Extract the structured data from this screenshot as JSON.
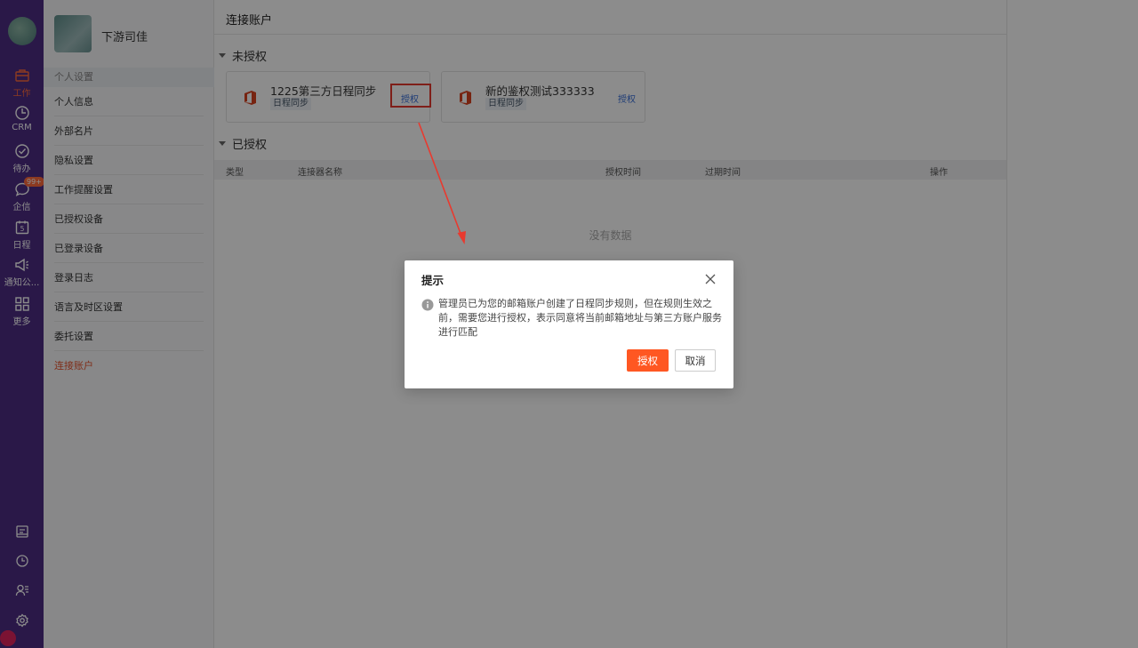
{
  "user": {
    "name": "下游司佳"
  },
  "rail": {
    "items": [
      {
        "label": "工作",
        "icon": "briefcase-icon"
      },
      {
        "label": "CRM",
        "icon": "clock-icon"
      },
      {
        "label": "待办",
        "icon": "check-circle-icon"
      },
      {
        "label": "企信",
        "icon": "chat-icon"
      },
      {
        "label": "日程",
        "icon": "calendar-icon",
        "calendar_day": "5"
      },
      {
        "label": "通知公...",
        "icon": "megaphone-icon"
      },
      {
        "label": "更多",
        "icon": "grid-icon"
      }
    ],
    "chat_badge": "99+",
    "bottom_icons": [
      "inbox-icon",
      "history-icon",
      "contacts-icon",
      "settings-icon"
    ]
  },
  "side": {
    "section_title": "个人设置",
    "items": [
      "个人信息",
      "外部名片",
      "隐私设置",
      "工作提醒设置",
      "已授权设备",
      "已登录设备",
      "登录日志",
      "语言及时区设置",
      "委托设置",
      "连接账户"
    ],
    "active_item": "连接账户"
  },
  "main": {
    "title": "连接账户",
    "unauthorized_title": "未授权",
    "authorized_title": "已授权",
    "cards": [
      {
        "name": "1225第三方日程同步",
        "tag": "日程同步",
        "action": "授权"
      },
      {
        "name": "新的鉴权测试333333",
        "tag": "日程同步",
        "action": "授权"
      }
    ],
    "table_columns": [
      "类型",
      "连接器名称",
      "授权时间",
      "过期时间",
      "操作"
    ],
    "empty_text": "没有数据"
  },
  "modal": {
    "title": "提示",
    "message": "管理员已为您的邮箱账户创建了日程同步规则，但在规则生效之前，需要您进行授权，表示同意将当前邮箱地址与第三方账户服务进行匹配",
    "confirm_label": "授权",
    "cancel_label": "取消"
  },
  "colors": {
    "rail_bg": "#4d2d84",
    "accent": "#ff5722",
    "highlight_box": "#e83a2f",
    "link": "#3a6fd8"
  }
}
